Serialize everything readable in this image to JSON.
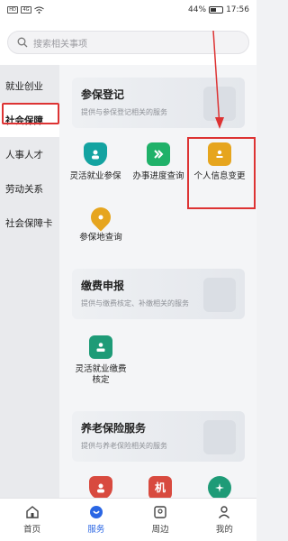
{
  "status": {
    "left_icons": [
      "HD",
      "4G",
      "wifi"
    ],
    "battery_pct": "44%",
    "time": "17:56"
  },
  "search": {
    "placeholder": "搜索相关事项"
  },
  "sidebar": {
    "items": [
      {
        "label": "就业创业"
      },
      {
        "label": "社会保障"
      },
      {
        "label": "人事人才"
      },
      {
        "label": "劳动关系"
      },
      {
        "label": "社会保障卡"
      }
    ],
    "active_index": 1
  },
  "sections": [
    {
      "title": "参保登记",
      "desc": "提供与参保登记相关的服务",
      "services": [
        {
          "label": "灵活就业参保",
          "icon": "shield-person-icon",
          "color": "#13a3a1"
        },
        {
          "label": "办事进度查询",
          "icon": "double-chevron-icon",
          "color": "#1fb169"
        },
        {
          "label": "个人信息变更",
          "icon": "id-card-icon",
          "color": "#e6a51e"
        },
        {
          "label": "参保地查询",
          "icon": "location-pin-icon",
          "color": "#e6a51e"
        }
      ]
    },
    {
      "title": "缴费申报",
      "desc": "提供与缴费核定、补缴相关的服务",
      "services": [
        {
          "label": "灵活就业缴费核定",
          "icon": "person-card-icon",
          "color": "#1e9b77"
        }
      ]
    },
    {
      "title": "养老保险服务",
      "desc": "提供与养老保险相关的服务",
      "services": [
        {
          "label": "",
          "icon": "shield-person-icon",
          "color": "#d84a3f"
        },
        {
          "label": "机",
          "icon": "badge-icon",
          "color": "#d84a3f"
        },
        {
          "label": "",
          "icon": "star-icon",
          "color": "#1e9b77"
        }
      ]
    }
  ],
  "bottom_nav": {
    "tabs": [
      {
        "label": "首页",
        "icon": "home-icon"
      },
      {
        "label": "服务",
        "icon": "service-icon"
      },
      {
        "label": "周边",
        "icon": "nearby-icon"
      },
      {
        "label": "我的",
        "icon": "profile-icon"
      }
    ],
    "active_index": 1,
    "accent": "#2a66e4"
  },
  "annotation_color": "#d33333"
}
